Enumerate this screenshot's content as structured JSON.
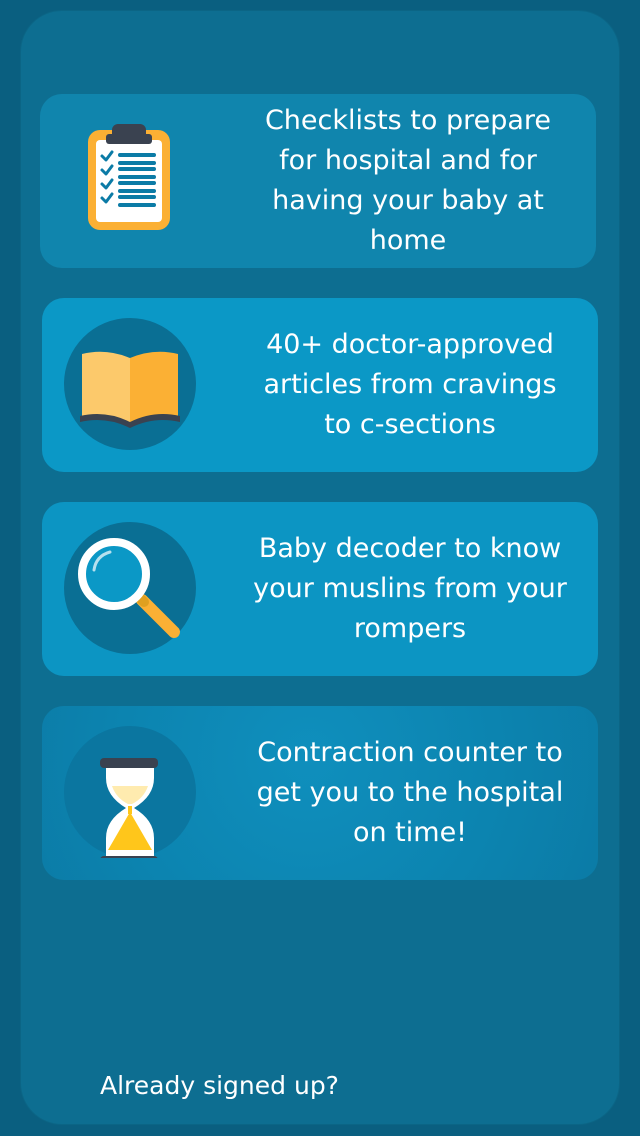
{
  "features": [
    {
      "text": "Checklists to prepare for hospital and for having your baby at home",
      "icon": "clipboard-checklist-icon"
    },
    {
      "text": "40+ doctor-approved articles from cravings to c-sections",
      "icon": "open-book-icon"
    },
    {
      "text": "Baby decoder to know your muslins from your rompers",
      "icon": "magnifying-glass-icon"
    },
    {
      "text": "Contraction counter to get you to the hospital on time!",
      "icon": "hourglass-icon"
    }
  ],
  "footer": {
    "already_signed_up": "Already signed up?"
  },
  "colors": {
    "background": "#0a5f80",
    "panel": "#0d6e91",
    "card_light": "#0b98c6",
    "accent_orange": "#fbb034",
    "accent_yellow": "#ffc61b"
  }
}
